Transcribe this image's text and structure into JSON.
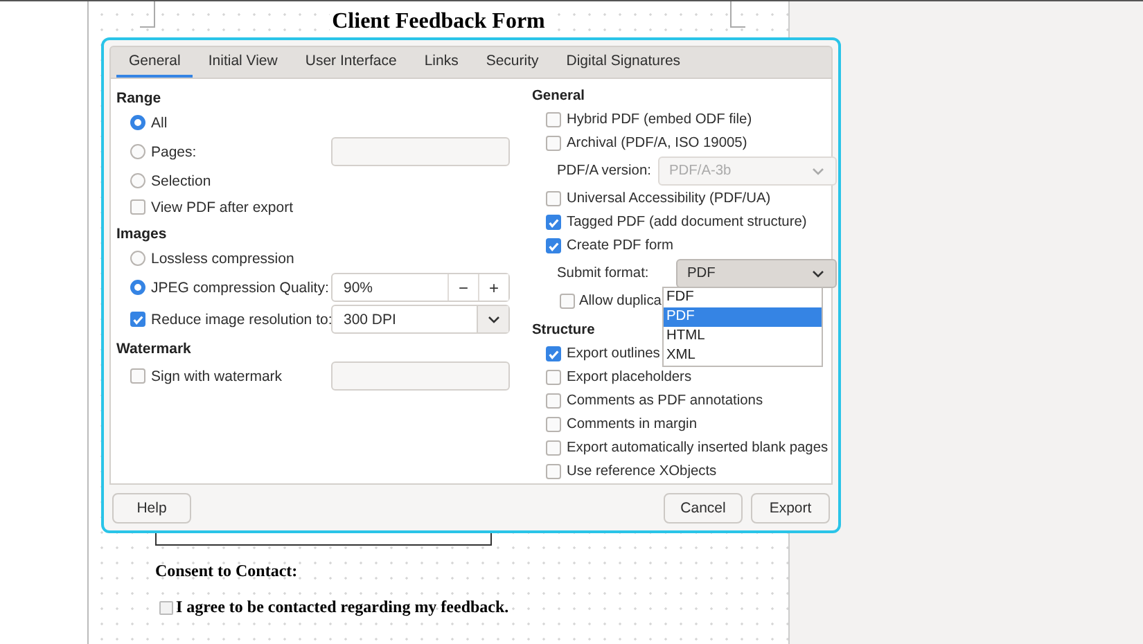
{
  "document": {
    "title": "Client Feedback Form",
    "consent_heading": "Consent to Contact:",
    "consent_checkbox": {
      "label": "I agree to be contacted regarding my feedback.",
      "checked": false
    }
  },
  "dialog": {
    "tabs": [
      {
        "label": "General",
        "selected": true
      },
      {
        "label": "Initial View",
        "selected": false
      },
      {
        "label": "User Interface",
        "selected": false
      },
      {
        "label": "Links",
        "selected": false
      },
      {
        "label": "Security",
        "selected": false
      },
      {
        "label": "Digital Signatures",
        "selected": false
      }
    ],
    "left": [
      {
        "heading": "Range",
        "rows": [
          {
            "kind": "radio",
            "label": "All",
            "selected": true
          },
          {
            "kind": "radio",
            "label": "Pages:",
            "selected": false,
            "control": {
              "kind": "field"
            }
          },
          {
            "kind": "radio",
            "label": "Selection",
            "selected": false
          },
          {
            "kind": "checkbox",
            "label": "View PDF after export",
            "checked": false
          }
        ]
      },
      {
        "heading": "Images",
        "rows": [
          {
            "kind": "radio",
            "label": "Lossless compression",
            "selected": false
          },
          {
            "kind": "radio",
            "label": "JPEG compression  Quality:",
            "selected": true,
            "control": {
              "kind": "spin",
              "value": "90%",
              "minus": "−",
              "plus": "+"
            }
          },
          {
            "kind": "checkbox",
            "label": "Reduce image resolution to:",
            "checked": true,
            "control": {
              "kind": "combo",
              "value": "300 DPI"
            }
          }
        ]
      },
      {
        "heading": "Watermark",
        "rows": [
          {
            "kind": "checkbox",
            "label": "Sign with watermark",
            "checked": false,
            "control": {
              "kind": "field"
            }
          }
        ]
      }
    ],
    "right": [
      {
        "heading": "General",
        "rows": [
          {
            "kind": "checkbox",
            "label": "Hybrid PDF (embed ODF file)",
            "checked": false
          },
          {
            "kind": "checkbox",
            "label": "Archival (PDF/A, ISO 19005)",
            "checked": false
          },
          {
            "kind": "select",
            "label": "PDF/A version:",
            "value": "PDF/A-3b",
            "disabled": true,
            "open": false
          },
          {
            "kind": "checkbox",
            "label": "Universal Accessibility (PDF/UA)",
            "checked": false
          },
          {
            "kind": "checkbox",
            "label": "Tagged PDF (add document structure)",
            "checked": true
          },
          {
            "kind": "checkbox",
            "label": "Create PDF form",
            "checked": true
          },
          {
            "kind": "select",
            "label": "Submit format:",
            "value": "PDF",
            "disabled": false,
            "open": true,
            "options": [
              {
                "label": "FDF",
                "selected": false
              },
              {
                "label": "PDF",
                "selected": true
              },
              {
                "label": "HTML",
                "selected": false
              },
              {
                "label": "XML",
                "selected": false
              }
            ]
          },
          {
            "kind": "subcheckbox",
            "label": "Allow duplica",
            "checked": false
          }
        ]
      },
      {
        "heading": "Structure",
        "rows": [
          {
            "kind": "checkbox",
            "label": "Export outlines",
            "checked": true
          },
          {
            "kind": "checkbox",
            "label": "Export placeholders",
            "checked": false
          },
          {
            "kind": "checkbox",
            "label": "Comments as PDF annotations",
            "checked": false
          },
          {
            "kind": "checkbox",
            "label": "Comments in margin",
            "checked": false
          },
          {
            "kind": "checkbox",
            "label": "Export automatically inserted blank pages",
            "checked": false
          },
          {
            "kind": "checkbox",
            "label": "Use reference XObjects",
            "checked": false
          }
        ]
      }
    ],
    "buttons": {
      "help": "Help",
      "cancel": "Cancel",
      "export": "Export"
    }
  }
}
